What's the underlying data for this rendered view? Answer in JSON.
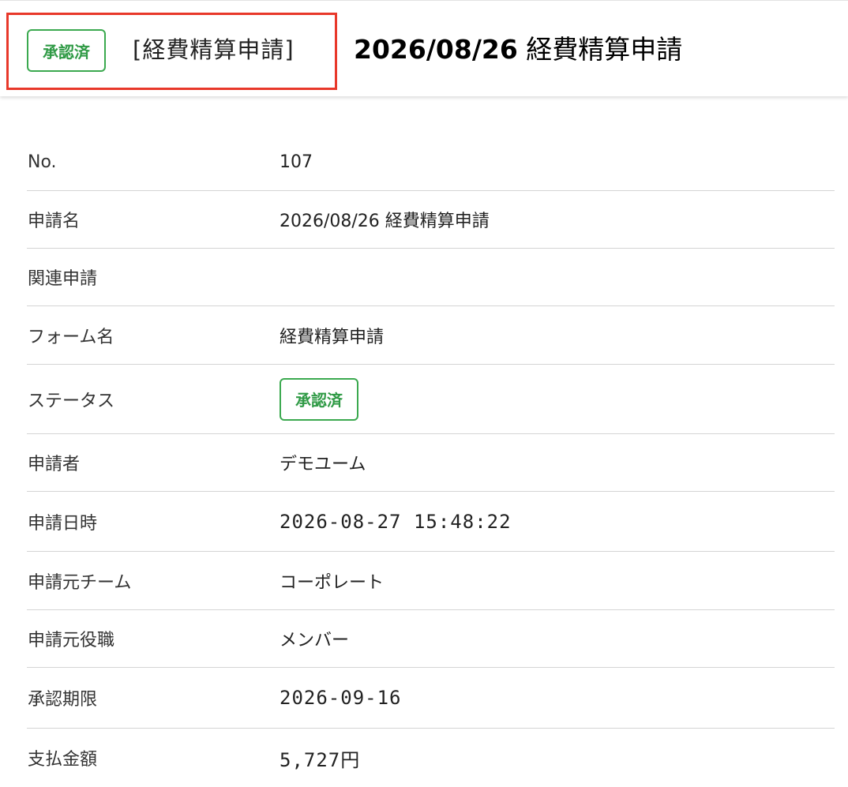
{
  "header": {
    "status_badge": "承認済",
    "form_type": "[経費精算申請]",
    "title_date": "2026/08/26",
    "title_name": "経費精算申請"
  },
  "colors": {
    "badge_green": "#2f9a45",
    "highlight_red": "#e8382a"
  },
  "details": {
    "no": {
      "label": "No.",
      "value": "107"
    },
    "application_name": {
      "label": "申請名",
      "value": "2026/08/26 経費精算申請"
    },
    "related_application": {
      "label": "関連申請",
      "value": ""
    },
    "form_name": {
      "label": "フォーム名",
      "value": "経費精算申請"
    },
    "status": {
      "label": "ステータス",
      "value": "承認済"
    },
    "applicant": {
      "label": "申請者",
      "value": "デモユーム"
    },
    "applied_at": {
      "label": "申請日時",
      "value": "2026-08-27 15:48:22"
    },
    "team": {
      "label": "申請元チーム",
      "value": "コーポレート"
    },
    "role": {
      "label": "申請元役職",
      "value": "メンバー"
    },
    "deadline": {
      "label": "承認期限",
      "value": "2026-09-16"
    },
    "amount": {
      "label": "支払金額",
      "value": "5,727円"
    }
  }
}
